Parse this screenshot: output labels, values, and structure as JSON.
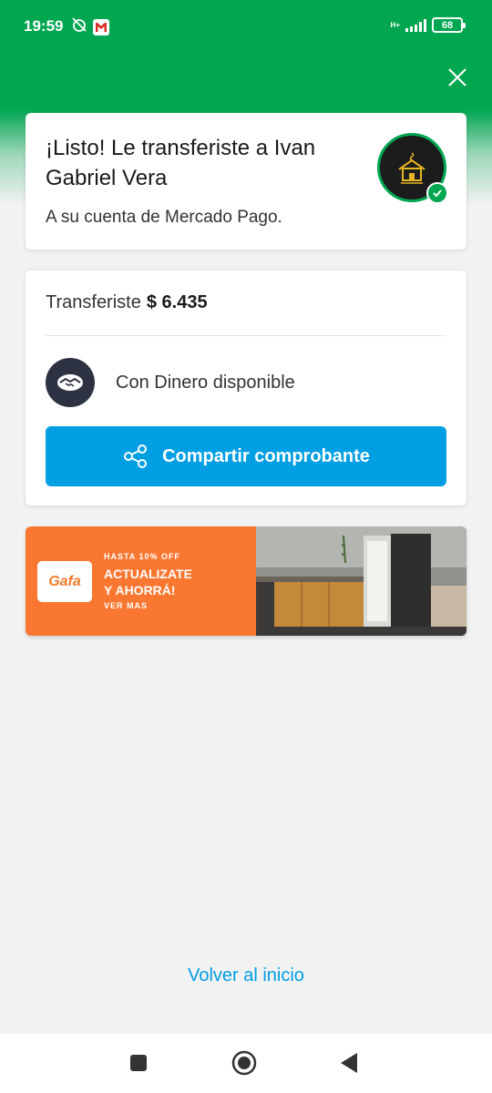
{
  "status_bar": {
    "time": "19:59",
    "network": "H+",
    "battery": "68"
  },
  "success": {
    "title": "¡Listo! Le transferiste a Ivan Gabriel Vera",
    "subtitle": "A su cuenta de Mercado Pago."
  },
  "detail": {
    "transfer_label": "Transferiste",
    "amount": "$ 6.435",
    "method": "Con Dinero disponible",
    "share_button": "Compartir comprobante"
  },
  "banner": {
    "brand": "Gafa",
    "small_top": "HASTA 10% OFF",
    "line1": "ACTUALIZATE",
    "line2": "Y AHORRÁ!",
    "small_bottom": "VER MAS"
  },
  "footer": {
    "back_home": "Volver al inicio"
  },
  "colors": {
    "brand_green": "#00a650",
    "action_blue": "#009ee3",
    "banner_orange": "#f97731"
  },
  "icons": [
    "close-icon",
    "share-icon",
    "handshake-icon",
    "check-icon",
    "house-logo-icon",
    "square-nav-icon",
    "home-nav-icon",
    "back-nav-icon"
  ]
}
